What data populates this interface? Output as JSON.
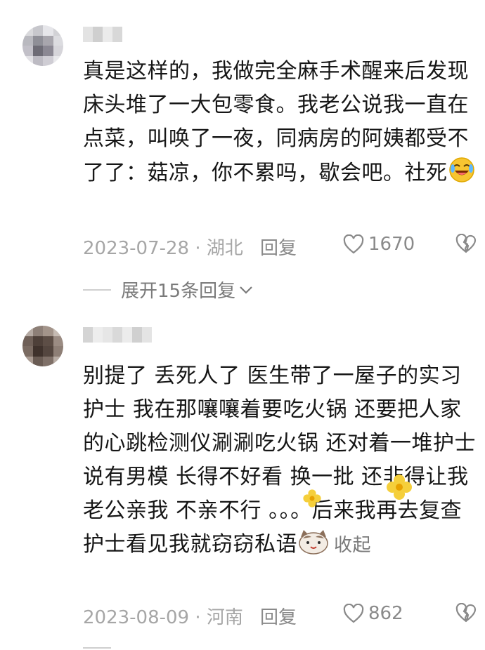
{
  "comments": [
    {
      "text": "真是这样的，我做完全麻手术醒来后发现床头堆了一大包零食。我老公说我一直在点菜，叫唤了一夜，同病房的阿姨都受不了了：菇凉，你不累吗，歇会吧。社死",
      "emoji": "laughing-crying-emoji",
      "date": "2023-07-28",
      "separator": "·",
      "location": "湖北",
      "reply_label": "回复",
      "like_count": "1670",
      "expand_label": "展开15条回复"
    },
    {
      "text": "别提了 丢死人了 医生带了一屋子的实习护士 我在那嚷嚷着要吃火锅 还要把人家的心跳检测仪涮涮吃火锅 还对着一堆护士说有男模 长得不好看 换一批 还非得让我老公亲我 不亲不行 。。。后来我再去复查 护士看见我就窃窃私语",
      "emoji": "cat-emoji",
      "collapse_label": "收起",
      "date": "2023-08-09",
      "separator": "·",
      "location": "河南",
      "reply_label": "回复",
      "like_count": "862"
    }
  ],
  "icons": {
    "like": "heart-outline-icon",
    "dislike": "broken-heart-icon",
    "expand": "chevron-down-icon"
  },
  "colors": {
    "text": "#161616",
    "meta": "#a6a6a6",
    "accent": "#8a8a8a"
  }
}
